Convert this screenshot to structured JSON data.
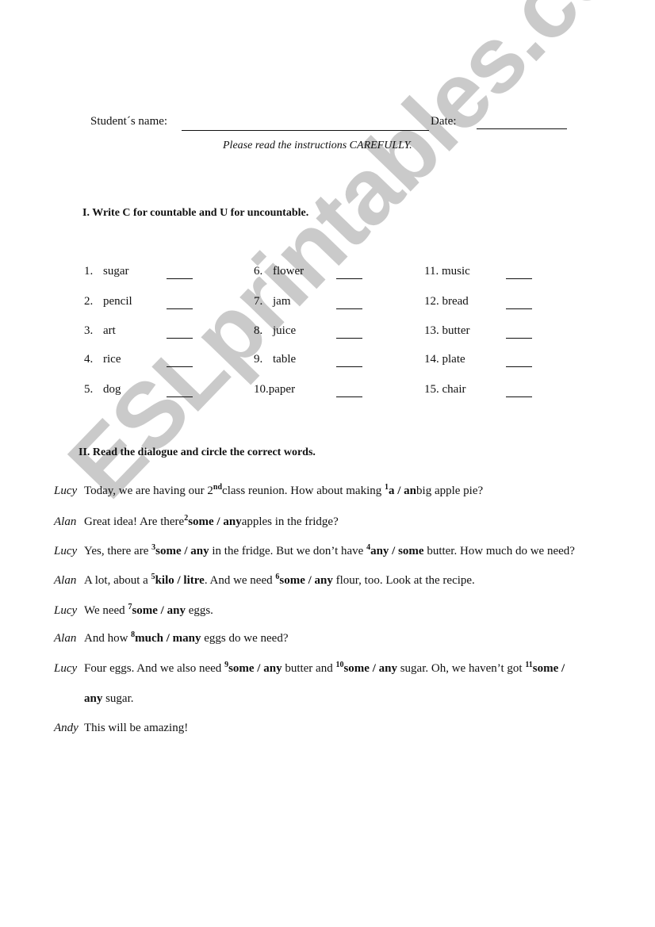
{
  "header": {
    "student_name_label": "Student´s name:",
    "date_label": "Date:",
    "instruction": "Please read the instructions CAREFULLY."
  },
  "section1": {
    "title": "I.  Write C for countable and U for uncountable.",
    "items": [
      {
        "num": "1.",
        "word": "sugar",
        "blank": "____"
      },
      {
        "num": "2.",
        "word": "pencil",
        "blank": "____"
      },
      {
        "num": "3.",
        "word": "art",
        "blank": "____"
      },
      {
        "num": "4.",
        "word": "rice",
        "blank": "____"
      },
      {
        "num": "5.",
        "word": "dog",
        "blank": "____"
      },
      {
        "num": "6.",
        "word": "flower",
        "blank": "____"
      },
      {
        "num": "7.",
        "word": "jam",
        "blank": "____"
      },
      {
        "num": "8.",
        "word": "juice",
        "blank": "____"
      },
      {
        "num": "9.",
        "word": "table",
        "blank": "____"
      },
      {
        "num": "10.",
        "word": "paper",
        "blank": "____"
      },
      {
        "num": "11.",
        "word": "music",
        "blank": "____"
      },
      {
        "num": "12.",
        "word": "bread",
        "blank": "____"
      },
      {
        "num": "13.",
        "word": "butter",
        "blank": "____"
      },
      {
        "num": "14.",
        "word": "plate",
        "blank": "____"
      },
      {
        "num": "15.",
        "word": "chair",
        "blank": "____"
      }
    ]
  },
  "section2": {
    "title": "II.  Read the dialogue and circle the correct words.",
    "lines": [
      {
        "speaker": "Lucy",
        "parts": [
          "Today, we are having our 2",
          "nd",
          "class reunion. How about making ",
          "1",
          "a / an",
          "big apple pie?"
        ]
      },
      {
        "speaker": "Alan",
        "parts": [
          "Great idea! Are there",
          "2",
          "some / any",
          "apples in the fridge?"
        ]
      },
      {
        "speaker": "Lucy",
        "parts": [
          "Yes, there are ",
          "3",
          "some / any",
          " in the fridge. But we don’t have ",
          "4",
          "any / some",
          " butter. How much do we need?"
        ]
      },
      {
        "speaker": "Alan",
        "parts": [
          "A lot, about a ",
          "5",
          "kilo / litre",
          ". And we need ",
          "6",
          "some / any",
          " flour, too. Look at the recipe."
        ]
      },
      {
        "speaker": "Lucy",
        "parts": [
          "We need ",
          "7",
          "some / any",
          " eggs."
        ]
      },
      {
        "speaker": "Alan",
        "parts": [
          "And how ",
          "8",
          "much / many",
          " eggs do we need?"
        ]
      },
      {
        "speaker": "Lucy",
        "parts": [
          "Four eggs. And we also need ",
          "9",
          "some / any",
          " butter and ",
          "10",
          "some / any",
          " sugar. Oh, we haven’t got ",
          "11",
          "some /"
        ]
      },
      {
        "speaker": "",
        "parts": [
          "any",
          " sugar."
        ]
      },
      {
        "speaker": "Andy",
        "parts": [
          "This will be amazing!"
        ]
      }
    ]
  },
  "watermark": "ESLprintables.com"
}
